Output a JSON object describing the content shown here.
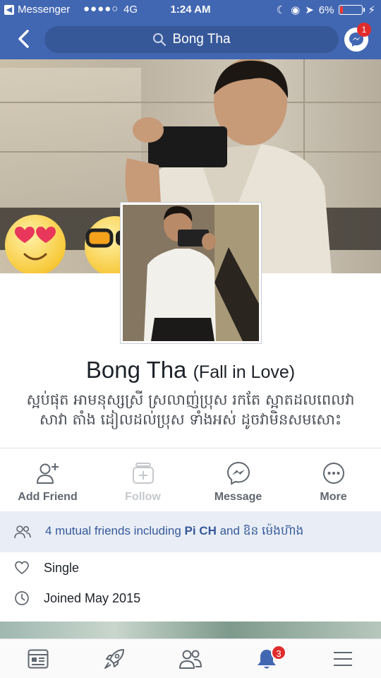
{
  "status_bar": {
    "back_app": "Messenger",
    "signal": "●●●●○",
    "network": "4G",
    "time": "1:24 AM",
    "battery": "6%"
  },
  "nav": {
    "search_text": "Bong Tha",
    "messenger_badge": "1"
  },
  "profile": {
    "name": "Bong Tha",
    "name_suffix": "(Fall in Love)",
    "bio": "ស្អប់ផុត អាមនុស្សស្រី ស្រលាញ់ប្រុស រកតែ ស្អាតដលពេលវា សាវា តាំង ដៀលដល់ប្រុស ទាំងអស់ ដូចវាមិនសមសោះ"
  },
  "actions": [
    {
      "label": "Add Friend",
      "icon": "add-friend-icon"
    },
    {
      "label": "Follow",
      "icon": "follow-icon"
    },
    {
      "label": "Message",
      "icon": "messenger-icon"
    },
    {
      "label": "More",
      "icon": "more-icon"
    }
  ],
  "mutual": {
    "prefix": "4 mutual friends including ",
    "friend1": "Pi CH",
    "and": " and ",
    "friend2": "ឱន ម៉េងហ៊ាង"
  },
  "info": {
    "relationship": "Single",
    "joined": "Joined May 2015"
  },
  "tabbar": {
    "notifications_badge": "3"
  },
  "colors": {
    "brand": "#4267b2",
    "link": "#365899",
    "badge": "#e02c2c"
  }
}
